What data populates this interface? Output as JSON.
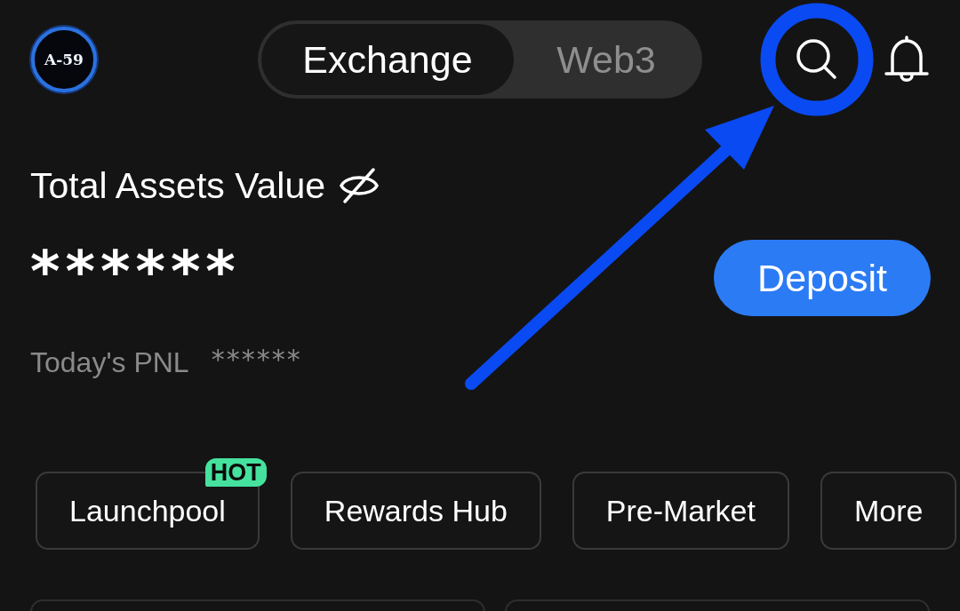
{
  "header": {
    "avatar": {
      "label": "A-59"
    },
    "tabs": [
      {
        "label": "Exchange",
        "selected": true
      },
      {
        "label": "Web3",
        "selected": false
      }
    ]
  },
  "assets": {
    "title": "Total Assets Value",
    "hidden": true,
    "value": "******",
    "deposit": "Deposit",
    "pnl_label": "Today's PNL",
    "pnl_value": "******"
  },
  "shortcuts": [
    {
      "label": "Launchpool",
      "badge": "HOT"
    },
    {
      "label": "Rewards Hub"
    },
    {
      "label": "Pre-Market"
    },
    {
      "label": "More"
    }
  ]
}
